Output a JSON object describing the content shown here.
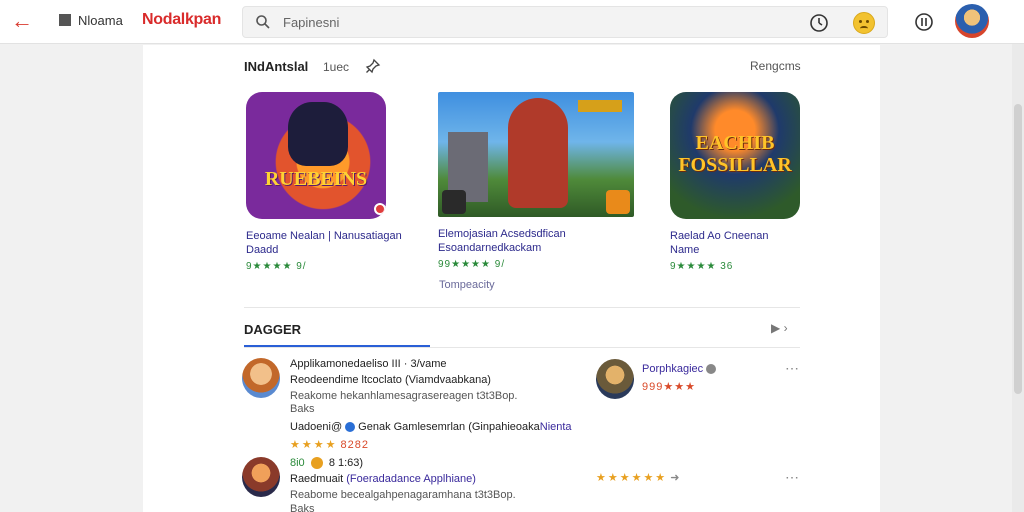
{
  "topbar": {
    "app_name": "Nloama",
    "brand": "Nodalkpan",
    "search_placeholder": "Fapinesni"
  },
  "section": {
    "title": "INdAntslal",
    "subtitle": "1uec",
    "see_more": "Rengcms"
  },
  "cards": [
    {
      "tile_text": "RUEBEINS",
      "title": "Eeoame Nealan | Nanusatiagan Daadd",
      "rating": "9★★★★ 9/"
    },
    {
      "tile_text": "",
      "title": "Elemojasian Acsedsdfican Esoandarnedkackam",
      "rating": "99★★★★ 9/"
    },
    {
      "tile_text": "EACHIB FOSSILLAR",
      "title": "Raelad Ao Cneenan Name",
      "rating": "9★★★★ 36"
    }
  ],
  "card_more": "Tompeacity",
  "tab": {
    "label": "DAGGER"
  },
  "reviews": [
    {
      "name": "Applikamonedaeliso III · 3/vame",
      "line2": "Reodeendime ltcoclato (Viamdvaabkana)",
      "line3": "Reakome hekanhlamesagrasereagen t3t3Bop.",
      "line4": "Baks",
      "reply_name": "Uadoeni@",
      "reply_text": "Genak Gamlesemrlan (Ginpahieoaka",
      "reply_link": "Nienta",
      "reply_stars": "★★★★",
      "reply_score": "8282"
    },
    {
      "name": "Porphkagiec",
      "score": "999★★★"
    },
    {
      "meta_green": "8i0",
      "meta_badge": "8",
      "meta_count": "1:63)",
      "name": "Raedmuait",
      "name_link": "(Foeradadance Applhiane)",
      "line2": "Reabome becealgahpenagaramhana t3t3Bop.",
      "line3": "Baks",
      "stars": "★★★★★★"
    }
  ]
}
